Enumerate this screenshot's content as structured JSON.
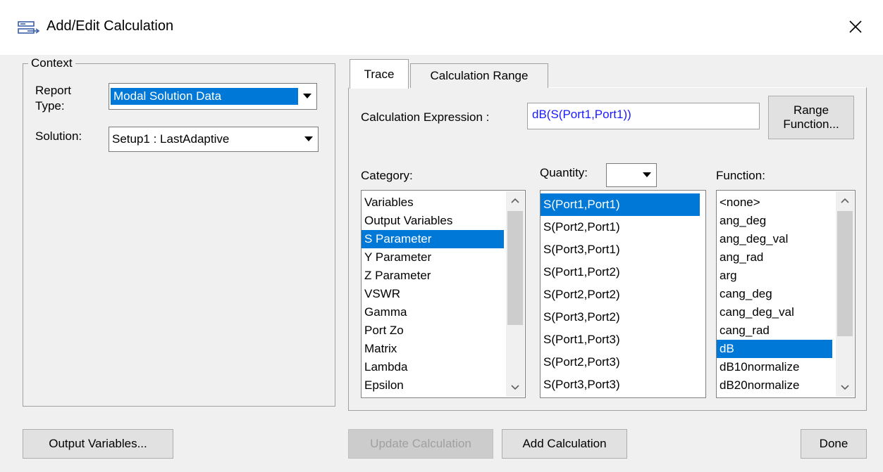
{
  "window": {
    "title": "Add/Edit Calculation",
    "close_label": "✕"
  },
  "context": {
    "legend": "Context",
    "report_type_label_1": "Report",
    "report_type_label_2": "Type:",
    "report_type_value": "Modal Solution Data",
    "solution_label": "Solution:",
    "solution_value": "Setup1 : LastAdaptive"
  },
  "tabs": [
    {
      "label": "Trace",
      "active": true
    },
    {
      "label": "Calculation Range",
      "active": false
    }
  ],
  "trace": {
    "expression_label": "Calculation Expression :",
    "expression_value": "dB(S(Port1,Port1))",
    "range_function_line1": "Range",
    "range_function_line2": "Function...",
    "category_label": "Category:",
    "quantity_label": "Quantity:",
    "quantity_filter_value": "",
    "function_label": "Function:",
    "categories": [
      "Variables",
      "Output Variables",
      "S Parameter",
      "Y Parameter",
      "Z Parameter",
      "VSWR",
      "Gamma",
      "Port Zo",
      "Matrix",
      "Lambda",
      "Epsilon"
    ],
    "category_selected": "S Parameter",
    "quantities": [
      "S(Port1,Port1)",
      "S(Port2,Port1)",
      "S(Port3,Port1)",
      "S(Port1,Port2)",
      "S(Port2,Port2)",
      "S(Port3,Port2)",
      "S(Port1,Port3)",
      "S(Port2,Port3)",
      "S(Port3,Port3)"
    ],
    "quantity_selected": "S(Port1,Port1)",
    "functions": [
      "<none>",
      "ang_deg",
      "ang_deg_val",
      "ang_rad",
      "arg",
      "cang_deg",
      "cang_deg_val",
      "cang_rad",
      "dB",
      "dB10normalize",
      "dB20normalize"
    ],
    "function_selected": "dB"
  },
  "buttons": {
    "output_variables": "Output Variables...",
    "update_calculation": "Update Calculation",
    "add_calculation": "Add Calculation",
    "done": "Done"
  },
  "colors": {
    "selection": "#0078d7",
    "expression_text": "#1a1aff",
    "disabled_text": "#a0a0a0"
  }
}
